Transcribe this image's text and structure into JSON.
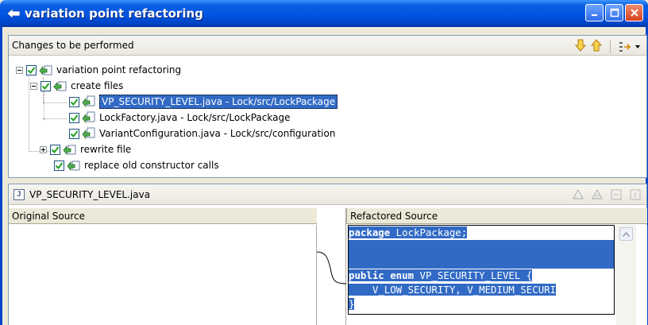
{
  "window": {
    "title": "variation point refactoring"
  },
  "changes_panel": {
    "header": "Changes to be performed",
    "tree": [
      {
        "label": "variation point refactoring",
        "checked": true,
        "expanded": true
      },
      {
        "label": "create files",
        "checked": true,
        "expanded": true
      },
      {
        "label": "VP_SECURITY_LEVEL.java - Lock/src/LockPackage",
        "checked": true,
        "selected": true
      },
      {
        "label": "LockFactory.java - Lock/src/LockPackage",
        "checked": true
      },
      {
        "label": "VariantConfiguration.java - Lock/src/configuration",
        "checked": true
      },
      {
        "label": "rewrite file",
        "checked": true,
        "expanded": false
      },
      {
        "label": "replace old constructor calls",
        "checked": true
      }
    ],
    "tool_icons": [
      "down-arrow-icon",
      "up-arrow-icon",
      "layout-menu-icon"
    ]
  },
  "compare_panel": {
    "file_title": "VP_SECURITY_LEVEL.java",
    "left_header": "Original Source",
    "right_header": "Refactored Source",
    "code_lines": [
      {
        "kw": "package",
        "rest": " LockPackage;"
      },
      {
        "kw": "",
        "rest": ""
      },
      {
        "kw": "",
        "rest": ""
      },
      {
        "kw": "public enum",
        "rest": " VP_SECURITY_LEVEL {"
      },
      {
        "kw": "",
        "rest": "    V_LOW_SECURITY, V_MEDIUM_SECURI"
      },
      {
        "kw": "",
        "rest": "}"
      }
    ]
  },
  "colors": {
    "title_bar": "#0054e3",
    "selection": "#316ac5",
    "check": "#21a121"
  }
}
